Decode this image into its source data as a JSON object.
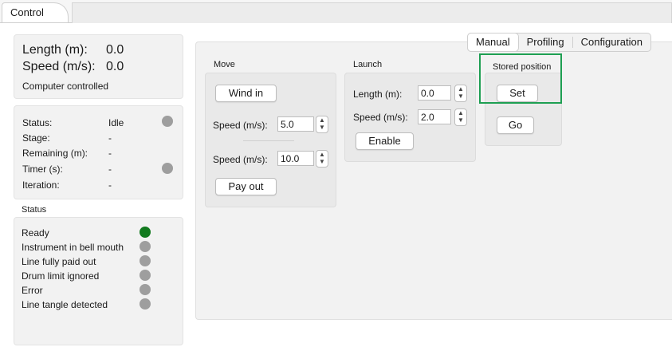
{
  "window": {
    "tab_label": "Control"
  },
  "readout": {
    "length_label": "Length (m):",
    "length_value": "0.0",
    "speed_label": "Speed (m/s):",
    "speed_value": "0.0",
    "mode": "Computer controlled"
  },
  "status_table": {
    "status_label": "Status:",
    "status_value": "Idle",
    "stage_label": "Stage:",
    "stage_value": "-",
    "remaining_label": "Remaining (m):",
    "remaining_value": "-",
    "timer_label": "Timer (s):",
    "timer_value": "-",
    "iteration_label": "Iteration:",
    "iteration_value": "-"
  },
  "status_section": {
    "heading": "Status",
    "flags": [
      {
        "label": "Ready",
        "color": "#127a1f"
      },
      {
        "label": "Instrument in bell mouth",
        "color": "#9e9e9e"
      },
      {
        "label": "Line fully paid out",
        "color": "#9e9e9e"
      },
      {
        "label": "Drum limit ignored",
        "color": "#9e9e9e"
      },
      {
        "label": "Error",
        "color": "#9e9e9e"
      },
      {
        "label": "Line tangle detected",
        "color": "#9e9e9e"
      }
    ]
  },
  "tabs": {
    "manual": "Manual",
    "profiling": "Profiling",
    "configuration": "Configuration"
  },
  "move": {
    "title": "Move",
    "wind_in": "Wind in",
    "speed_label": "Speed (m/s):",
    "wind_speed": "5.0",
    "payout_speed": "10.0",
    "pay_out": "Pay out"
  },
  "launch": {
    "title": "Launch",
    "length_label": "Length (m):",
    "length_value": "0.0",
    "speed_label": "Speed (m/s):",
    "speed_value": "2.0",
    "enable": "Enable"
  },
  "stored": {
    "title": "Stored position",
    "set": "Set",
    "go": "Go"
  },
  "colors": {
    "highlight": "#1e9f52",
    "ready": "#127a1f",
    "inactive": "#9e9e9e"
  }
}
